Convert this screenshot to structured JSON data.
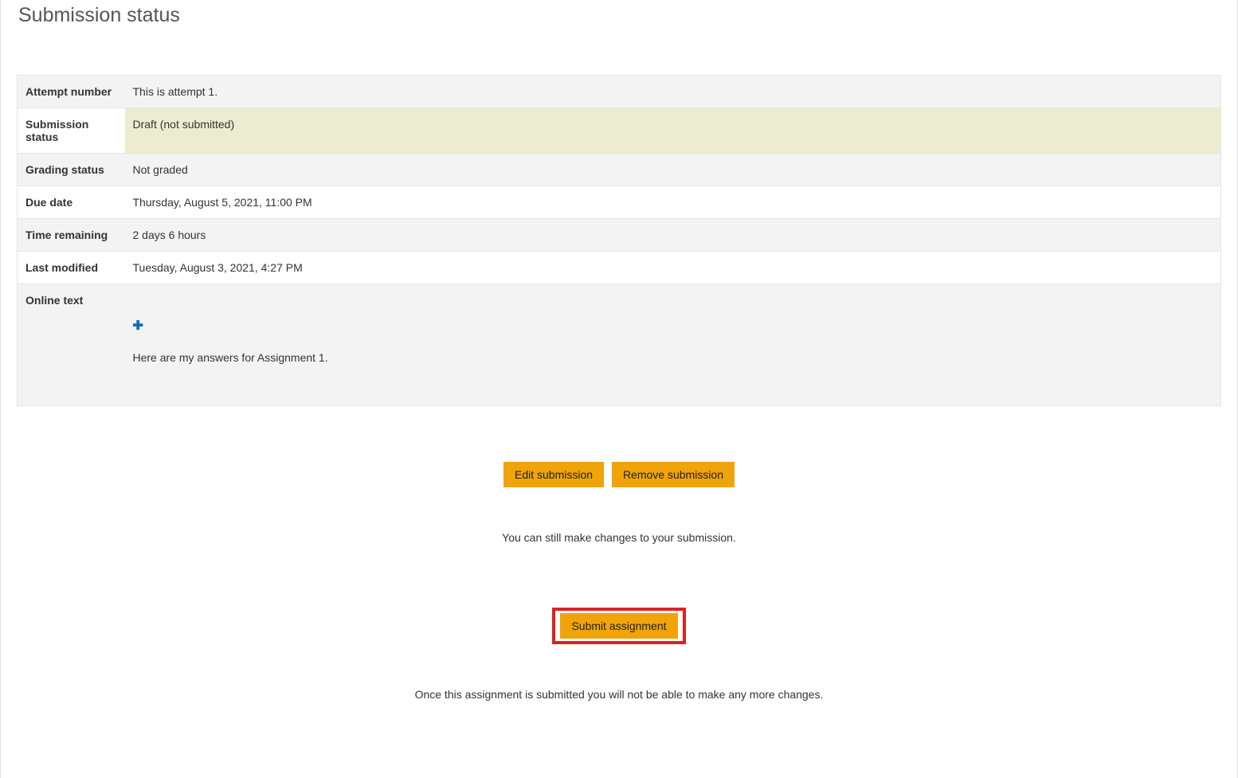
{
  "page_title": "Submission status",
  "table": {
    "rows": [
      {
        "label": "Attempt number",
        "value": "This is attempt 1."
      },
      {
        "label": "Submission status",
        "value": "Draft (not submitted)"
      },
      {
        "label": "Grading status",
        "value": "Not graded"
      },
      {
        "label": "Due date",
        "value": "Thursday, August 5, 2021, 11:00 PM"
      },
      {
        "label": "Time remaining",
        "value": "2 days 6 hours"
      },
      {
        "label": "Last modified",
        "value": "Tuesday, August 3, 2021, 4:27 PM"
      },
      {
        "label": "Online text",
        "value": "Here are my answers for Assignment 1."
      }
    ]
  },
  "buttons": {
    "edit": "Edit submission",
    "remove": "Remove submission",
    "submit": "Submit assignment"
  },
  "messages": {
    "can_change": "You can still make changes to your submission.",
    "once_submitted": "Once this assignment is submitted you will not be able to make any more changes."
  }
}
